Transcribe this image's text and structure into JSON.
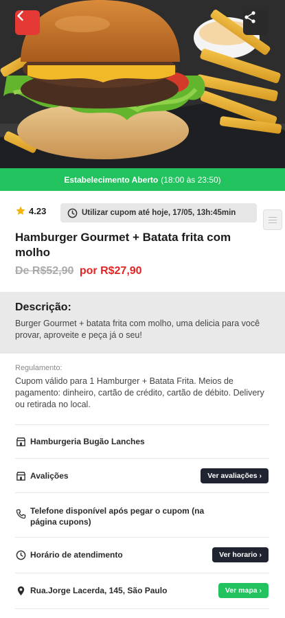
{
  "hero": {
    "image_alt": "Hamburger com batata frita"
  },
  "status": {
    "label": "Estabelecimento Aberto",
    "hours": "(18:00 às 23:50)"
  },
  "rating": {
    "value": "4.23"
  },
  "coupon": {
    "text": "Utilizar cupom até hoje, 17/05, 13h:45min"
  },
  "offer": {
    "title": "Hamburger Gourmet + Batata frita com molho",
    "price_old": "De R$52,90",
    "price_new": "por R$27,90"
  },
  "description": {
    "title": "Descrição:",
    "text": "Burger Gourmet + batata frita com molho, uma delicia para você provar, aproveite e peça já o seu!"
  },
  "regulation": {
    "label": "Regulamento:",
    "text": "Cupom válido para 1 Hamburger + Batata Frita. Meios de pagamento: dinheiro, cartão de crédito, cartão de débito. Delivery ou retirada no local."
  },
  "info": {
    "store": "Hamburgeria Bugão Lanches",
    "reviews": "Avalições",
    "reviews_button": "Ver avaliações ›",
    "phone": "Telefone disponível após pegar o cupom (na página cupons)",
    "hours": "Horário de atendimento",
    "hours_button": "Ver horario ›",
    "address": "Rua.Jorge Lacerda, 145, São Paulo",
    "map_button": "Ver mapa ›"
  },
  "colors": {
    "green": "#22c25f",
    "red": "#e02424",
    "dark": "#1f2430"
  }
}
